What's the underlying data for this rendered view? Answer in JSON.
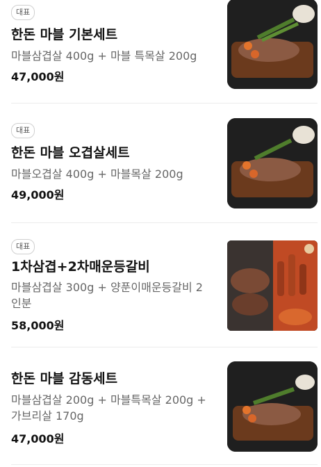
{
  "items": [
    {
      "badge": "대표",
      "title": "한돈 마블 기본세트",
      "description": "마블삼겹살 400g + 마블 특목살 200g",
      "price": "47,000원",
      "image": "grilled-pork-platter-icon"
    },
    {
      "badge": "대표",
      "title": "한돈 마블 오겹살세트",
      "description": "마블오겹살 400g + 마블목살 200g",
      "price": "49,000원",
      "image": "grilled-pork-platter-icon"
    },
    {
      "badge": "대표",
      "title": "1차삼겹+2차매운등갈비",
      "description": "마블삼겹살 300g + 양푼이매운등갈비 2인분",
      "price": "58,000원",
      "image": "pork-and-spicy-ribs-icon"
    },
    {
      "badge": "",
      "title": "한돈 마블 감동세트",
      "description": "마블삼겹살 200g + 마블특목살 200g + 가브리살 170g",
      "price": "47,000원",
      "image": "grilled-pork-platter-icon"
    }
  ],
  "colors": {
    "text": "#111111",
    "muted": "#666666",
    "divider": "#ececec"
  }
}
